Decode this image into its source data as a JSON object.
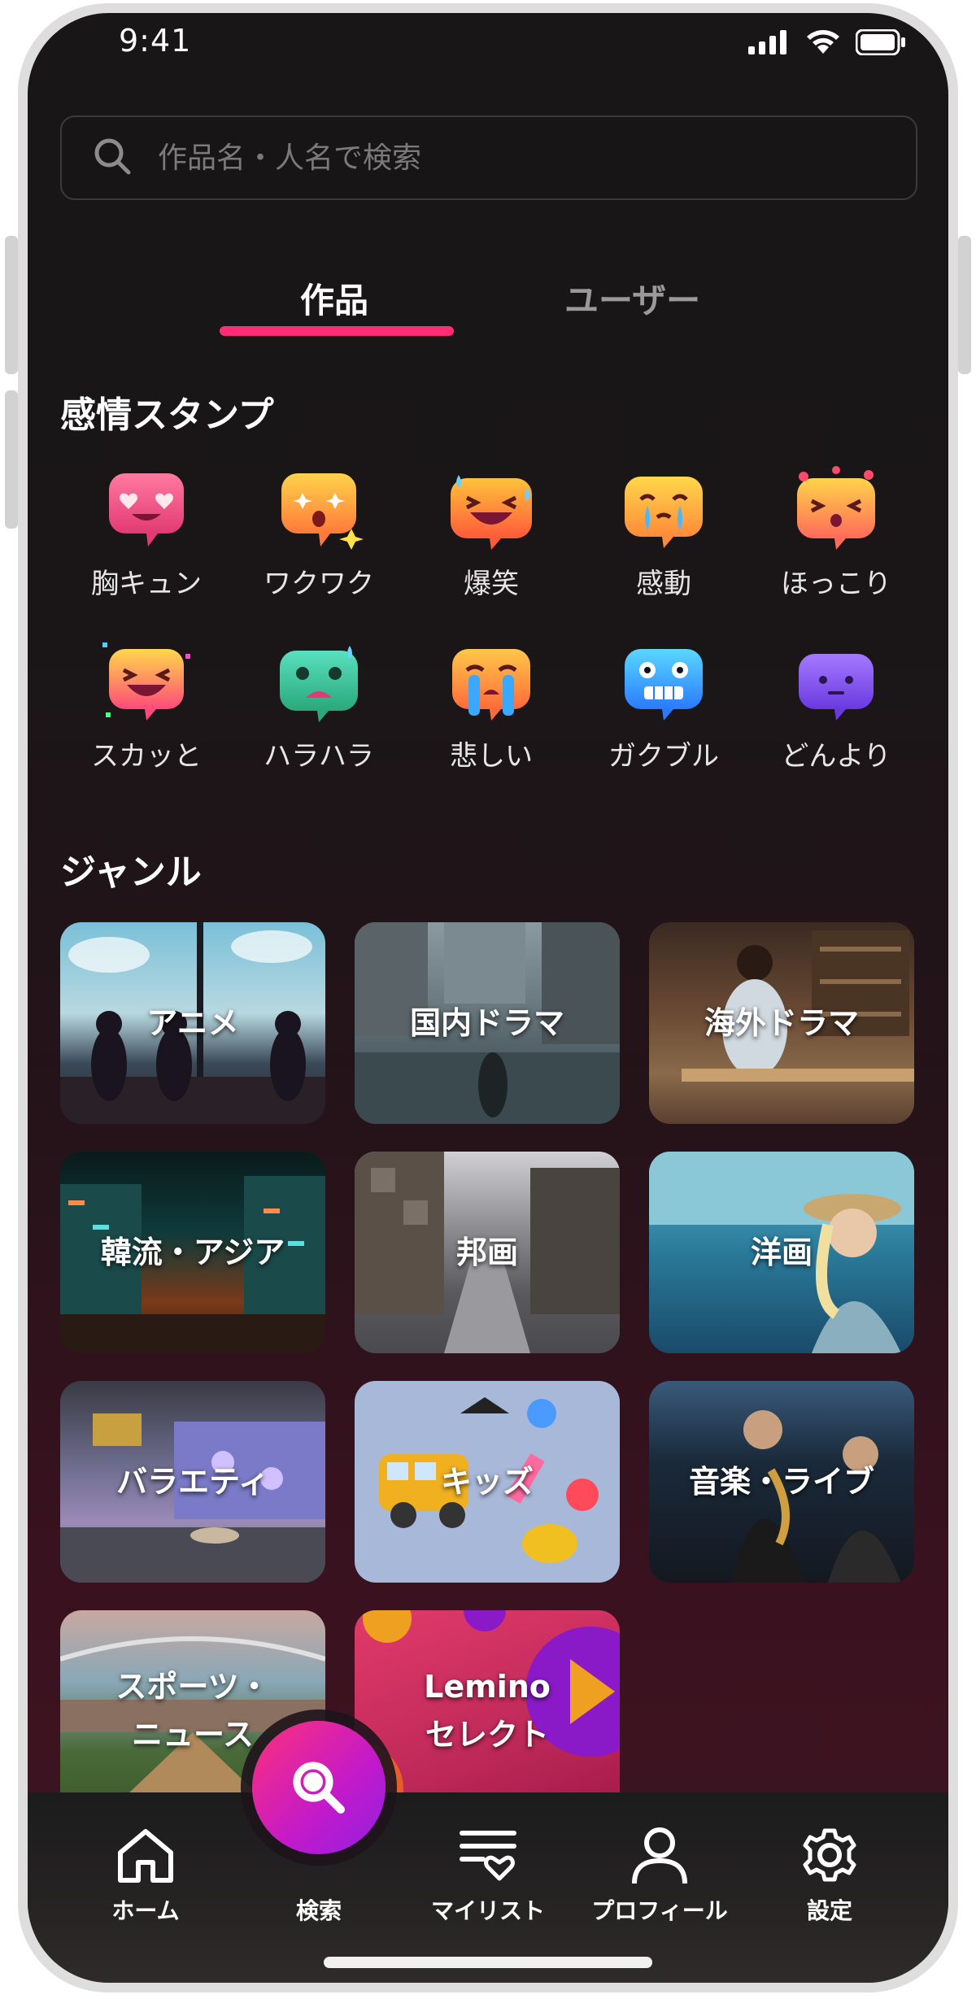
{
  "status_bar": {
    "time": "9:41"
  },
  "search": {
    "placeholder": "作品名・人名で検索"
  },
  "tabs": [
    {
      "label": "作品",
      "active": true
    },
    {
      "label": "ユーザー",
      "active": false
    }
  ],
  "colors": {
    "accent": "#ff2b75",
    "fab_gradient_start": "#ff2f7a",
    "fab_gradient_end": "#8f20e0"
  },
  "emotion_section": {
    "title": "感情スタンプ",
    "stamps": [
      {
        "label": "胸キュン",
        "icon": "heart-eyes-stamp-icon"
      },
      {
        "label": "ワクワク",
        "icon": "excited-stamp-icon"
      },
      {
        "label": "爆笑",
        "icon": "laughing-stamp-icon"
      },
      {
        "label": "感動",
        "icon": "moved-tears-stamp-icon"
      },
      {
        "label": "ほっこり",
        "icon": "warm-stamp-icon"
      },
      {
        "label": "スカッと",
        "icon": "refreshing-stamp-icon"
      },
      {
        "label": "ハラハラ",
        "icon": "nervous-stamp-icon"
      },
      {
        "label": "悲しい",
        "icon": "sad-stamp-icon"
      },
      {
        "label": "ガクブル",
        "icon": "scared-stamp-icon"
      },
      {
        "label": "どんより",
        "icon": "gloomy-stamp-icon"
      }
    ]
  },
  "genre_section": {
    "title": "ジャンル",
    "genres": [
      {
        "label": "アニメ"
      },
      {
        "label": "国内ドラマ"
      },
      {
        "label": "海外ドラマ"
      },
      {
        "label": "韓流・アジア"
      },
      {
        "label": "邦画"
      },
      {
        "label": "洋画"
      },
      {
        "label": "バラエティ"
      },
      {
        "label": "キッズ"
      },
      {
        "label": "音楽・ライブ"
      },
      {
        "label": "スポーツ・\nニュース"
      },
      {
        "label": "Lemino\nセレクト"
      }
    ]
  },
  "bottom_nav": {
    "items": [
      {
        "label": "ホーム",
        "icon": "home-icon"
      },
      {
        "label": "検索",
        "icon": "search-icon"
      },
      {
        "label": "マイリスト",
        "icon": "mylist-icon"
      },
      {
        "label": "プロフィール",
        "icon": "profile-icon"
      },
      {
        "label": "設定",
        "icon": "settings-gear-icon"
      }
    ]
  }
}
